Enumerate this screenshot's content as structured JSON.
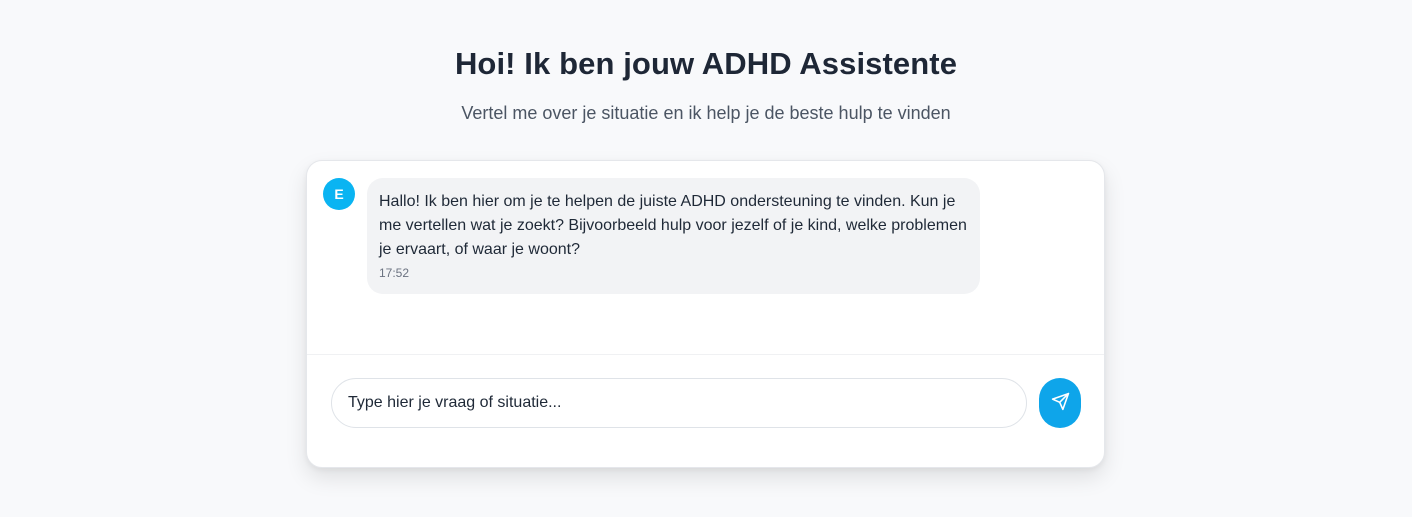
{
  "header": {
    "title": "Hoi! Ik ben jouw ADHD Assistente",
    "subtitle": "Vertel me over je situatie en ik help je de beste hulp te vinden"
  },
  "chat": {
    "messages": [
      {
        "sender_initial": "E",
        "text": "Hallo! Ik ben hier om je te helpen de juiste ADHD ondersteuning te vinden. Kun je me vertellen wat je zoekt? Bijvoorbeeld hulp voor jezelf of je kind, welke problemen je ervaart, of waar je woont?",
        "time": "17:52"
      }
    ],
    "input": {
      "placeholder": "Type hier je vraag of situatie...",
      "value": ""
    },
    "send_icon": "send-icon"
  },
  "colors": {
    "background": "#f8f9fb",
    "accent": "#0ea5ea",
    "avatar": "#0ab4f2",
    "bubble": "#f2f3f5",
    "title": "#1e2736"
  }
}
